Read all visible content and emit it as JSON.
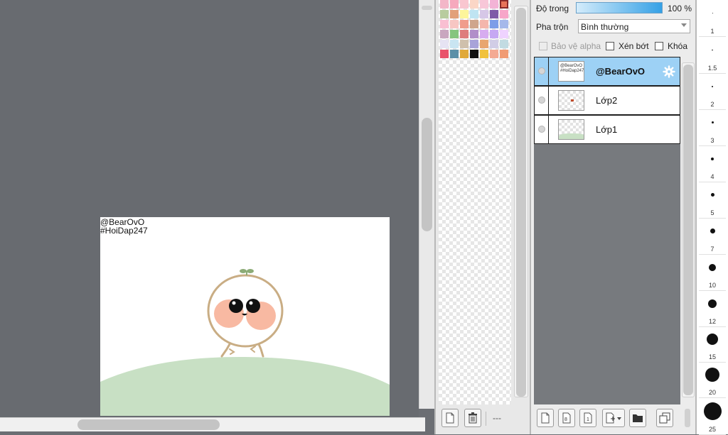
{
  "canvas": {
    "artwork_text_line1": "@BearOvO",
    "artwork_text_line2": "#HoiDap247",
    "colors": {
      "background": "#686b70",
      "ground": "#c8e0c4",
      "blush": "#f8b9a2",
      "outline": "#c9ad84",
      "sprout": "#8cab76"
    }
  },
  "palette": {
    "swatches": [
      "#f3b6c8",
      "#f6a9bd",
      "#f9c6d0",
      "#fbd6c6",
      "#f8c7d8",
      "#f3b3d6",
      "#e7745a",
      "#b8cc9e",
      "#e2a07a",
      "#fdf59a",
      "#bfe4f2",
      "#d6c7e7",
      "#7e5aa8",
      "#f7a6c9",
      "#f9bfd2",
      "#f7c6c3",
      "#f09c8c",
      "#cfa58c",
      "#f4b6ac",
      "#7d9de8",
      "#a5b8ea",
      "#c9a6bf",
      "#85c57e",
      "#de7c7c",
      "#b18ec9",
      "#d7acf0",
      "#c6a8f3",
      "#efd3ff",
      "#e6e3f3",
      "#c9e5f2",
      "#cfc0ac",
      "#a8a3d9",
      "#e8a66f",
      "#d1cde6",
      "#c2dbe2",
      "#e9536b",
      "#5b8fa8",
      "#e0a93a",
      "#111111",
      "#f1c23c",
      "#f4aa93",
      "#f09b73"
    ],
    "selected_index": 6,
    "status_text": "---"
  },
  "layers_panel": {
    "opacity_label": "Độ trong",
    "opacity_value": "100 %",
    "blend_label": "Pha trộn",
    "blend_value": "Bình thường",
    "protect_alpha_label": "Bảo vệ alpha",
    "clip_label": "Xén bớt",
    "lock_label": "Khóa",
    "layers": [
      {
        "name": "@BearOvO",
        "selected": true
      },
      {
        "name": "Lớp2",
        "selected": false
      },
      {
        "name": "Lớp1",
        "selected": false
      }
    ]
  },
  "brush_sizes": {
    "labels": [
      "1",
      "1.5",
      "2",
      "3",
      "4",
      "5",
      "7",
      "10",
      "12",
      "15",
      "20",
      "25"
    ]
  }
}
